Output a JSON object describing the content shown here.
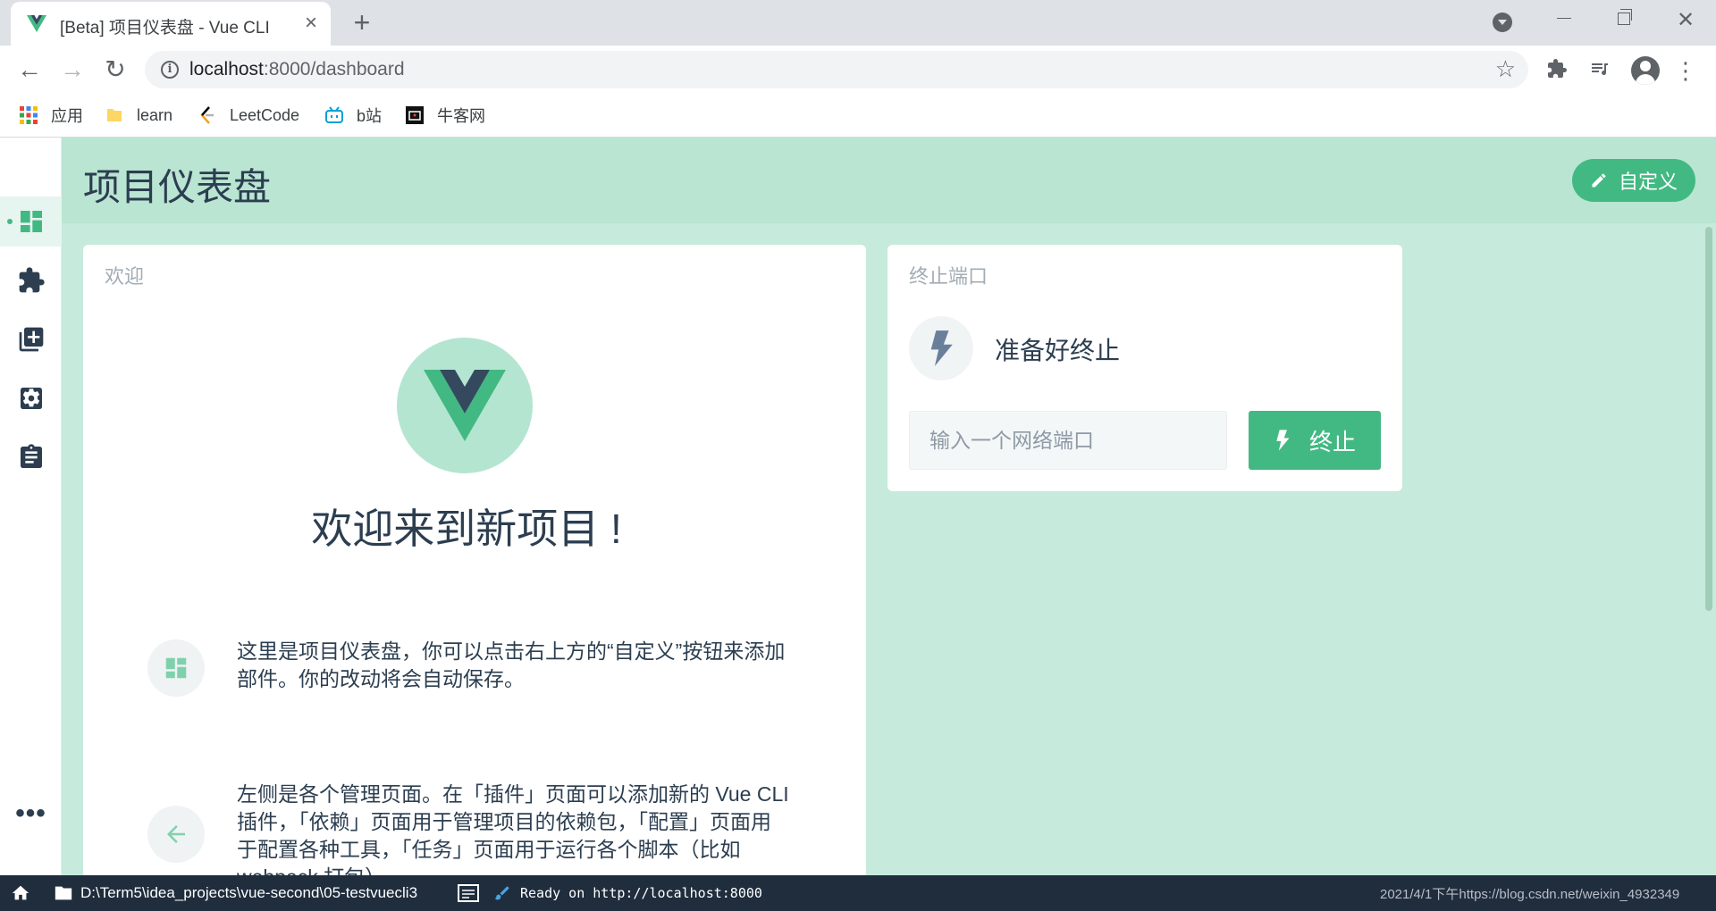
{
  "browser": {
    "tab": {
      "title": "[Beta] 项目仪表盘 - Vue CLI"
    },
    "url": {
      "host": "localhost",
      "rest": ":8000/dashboard"
    },
    "bookmarks": [
      {
        "label": "应用",
        "icon": "apps-grid-icon"
      },
      {
        "label": "learn",
        "icon": "folder-icon"
      },
      {
        "label": "LeetCode",
        "icon": "leetcode-icon"
      },
      {
        "label": "b站",
        "icon": "bilibili-icon"
      },
      {
        "label": "牛客网",
        "icon": "nowcoder-icon"
      }
    ]
  },
  "app": {
    "page_title": "项目仪表盘",
    "customize_label": "自定义",
    "sidebar": {
      "items": [
        {
          "name": "dashboard",
          "icon": "dashboard-icon",
          "active": true
        },
        {
          "name": "plugins",
          "icon": "puzzle-icon",
          "active": false
        },
        {
          "name": "dependencies",
          "icon": "library-icon",
          "active": false
        },
        {
          "name": "configuration",
          "icon": "settings-icon",
          "active": false
        },
        {
          "name": "tasks",
          "icon": "clipboard-icon",
          "active": false
        }
      ],
      "more_label": "•••"
    },
    "welcome": {
      "title": "欢迎",
      "heading": "欢迎来到新项目 !",
      "tip1": "这里是项目仪表盘，你可以点击右上方的“自定义”按钮来添加部件。你的改动将会自动保存。",
      "tip2": "左侧是各个管理页面。在「插件」页面可以添加新的 Vue CLI 插件，「依赖」页面用于管理项目的依赖包，「配置」页面用于配置各种工具，「任务」页面用于运行各个脚本（比如 webpack 打包）。"
    },
    "kill_port": {
      "title": "终止端口",
      "status": "准备好终止",
      "input_placeholder": "输入一个网络端口",
      "button_label": "终止"
    }
  },
  "taskbar": {
    "path": "D:\\Term5\\idea_projects\\vue-second\\05-testvuecli3",
    "ready": "Ready on http://localhost:8000",
    "right_text": "2021/4/1下午https://blog.csdn.net/weixin_4932349"
  },
  "colors": {
    "accent": "#42b983",
    "header_bg": "#b9e5d2",
    "content_bg": "#c6eadb",
    "text": "#2c3e50",
    "vue_dark": "#34495e"
  }
}
